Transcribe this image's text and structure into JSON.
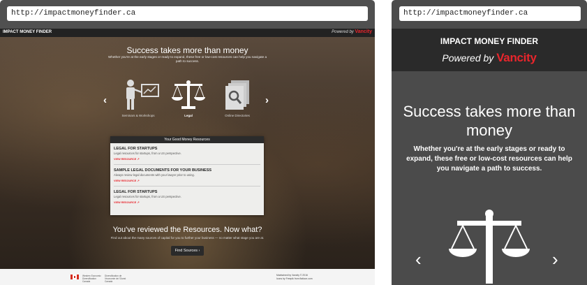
{
  "desktop": {
    "url": "http://impactmoneyfinder.ca",
    "brand": "IMPACT MONEY FINDER",
    "powered_by": "Powered by",
    "powered_brand": "Vancity",
    "hero": {
      "title": "Success takes more than money",
      "subtitle": "Whether you're at the early stages or ready to expand, these free or low-cost resources can help you navigate a path to success."
    },
    "carousel": [
      {
        "label": "Seminars & Workshops",
        "icon": "presenter-icon"
      },
      {
        "label": "Legal",
        "icon": "scale-icon"
      },
      {
        "label": "Online Directories",
        "icon": "documents-search-icon"
      }
    ],
    "panel": {
      "title": "Your Good Money Resources",
      "resources": [
        {
          "title": "LEGAL FOR STARTUPS",
          "desc": "Legal resources for startups, from a US perspective.",
          "link": "VIEW RESOURCE ↗"
        },
        {
          "title": "SAMPLE LEGAL DOCUMENTS FOR YOUR BUSINESS",
          "desc": "Always review legal documents with your lawyer prior to using.",
          "link": "VIEW RESOURCE ↗"
        },
        {
          "title": "LEGAL FOR STARTUPS",
          "desc": "Legal resources for startups, from a US perspective.",
          "link": "VIEW RESOURCE ↗"
        }
      ]
    },
    "cta": {
      "title": "You've reviewed the Resources. Now what?",
      "subtitle": "Find out about the many sources of capital for you to further your business — no matter what stage you are at.",
      "button": "Find Sources ›"
    },
    "footer": {
      "gov_en": "Western Economic Diversification Canada",
      "gov_fr": "Diversification de l'économie de l'Ouest Canada",
      "maintained": "Maintained by Vancity © 2016",
      "credit": "Icons by Freepik from flaticon.com"
    }
  },
  "mobile": {
    "url": "http://impactmoneyfinder.ca",
    "brand": "IMPACT MONEY FINDER",
    "powered_by": "Powered by",
    "powered_brand": "Vancity",
    "title": "Success takes more than money",
    "subtitle": "Whether you're at the early stages or ready to expand, these free or low-cost resources can help you navigate a path to success.",
    "prev": "‹",
    "next": "›"
  },
  "colors": {
    "accent": "#e8252c",
    "dark": "#2a2a2a",
    "mobile_bg": "#4b4b4b"
  }
}
